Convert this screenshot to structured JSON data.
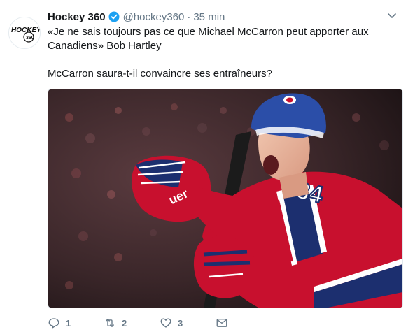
{
  "account": {
    "name": "Hockey 360",
    "handle": "@hockey360",
    "time": "35 min",
    "separator": "·",
    "avatar_text": "HOCKEY 360"
  },
  "tweet": {
    "line1": "«Je ne sais toujours pas ce que Michael McCarron peut apporter aux Canadiens» Bob Hartley",
    "line2": "McCarron saura-t-il convaincre ses entraîneurs?"
  },
  "media": {
    "jersey_number": "34",
    "glove_brand": "uer",
    "colors": {
      "jersey_red": "#c8102e",
      "jersey_blue": "#1c2f6f",
      "helmet_blue": "#2b4ea8"
    }
  },
  "actions": {
    "replies": "1",
    "retweets": "2",
    "likes": "3"
  },
  "colors": {
    "verified": "#1da1f2",
    "muted": "#657786"
  },
  "icons": [
    "verified-icon",
    "caret-down-icon",
    "reply-icon",
    "retweet-icon",
    "like-icon",
    "message-icon"
  ]
}
